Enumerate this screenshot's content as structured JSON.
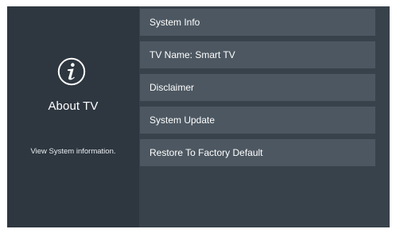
{
  "left_panel": {
    "icon": "info-icon",
    "title": "About TV",
    "description": "View System information."
  },
  "menu": {
    "items": [
      {
        "label": "System Info"
      },
      {
        "label": "TV Name: Smart TV"
      },
      {
        "label": "Disclaimer"
      },
      {
        "label": "System Update"
      },
      {
        "label": "Restore To Factory Default"
      }
    ]
  },
  "colors": {
    "screen_bg": "#37414a",
    "left_panel_bg": "#2e3740",
    "menu_item_bg": "#4c5761",
    "text": "#ffffff"
  }
}
